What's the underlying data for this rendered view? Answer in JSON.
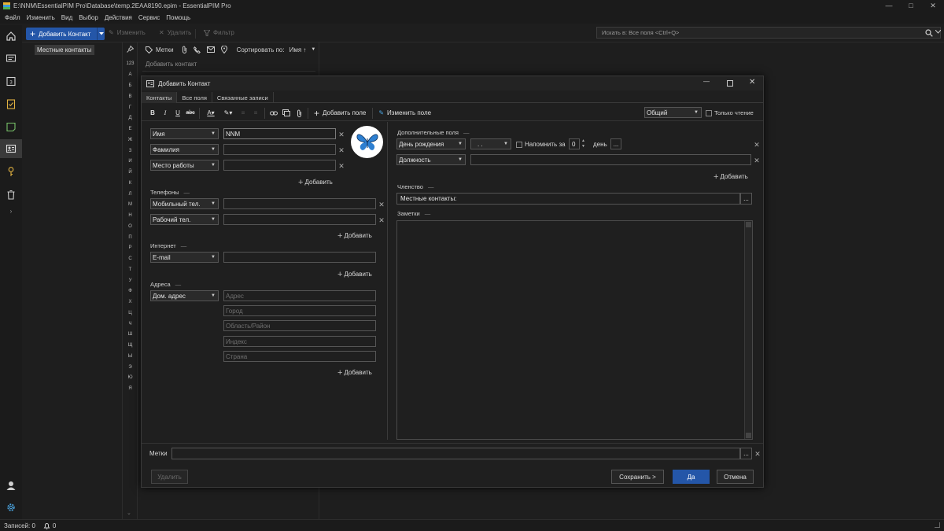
{
  "window": {
    "title": "E:\\NNM\\EssentialPIM Pro\\Database\\temp.2EAA8190.epim - EssentialPIM Pro"
  },
  "menu": [
    "Файл",
    "Изменить",
    "Вид",
    "Выбор",
    "Действия",
    "Сервис",
    "Помощь"
  ],
  "toolbar": {
    "add_contact": "Добавить Контакт",
    "edit": "Изменить",
    "delete": "Удалить",
    "filter": "Фильтр",
    "search_placeholder": "Искать в: Все поля  <Ctrl+Q>"
  },
  "left_panel": {
    "local_contacts": "Местные контакты"
  },
  "alphabet": [
    "123",
    "A",
    "Б",
    "В",
    "Г",
    "Д",
    "Е",
    "Ж",
    "З",
    "И",
    "Й",
    "К",
    "Л",
    "М",
    "Н",
    "О",
    "П",
    "Р",
    "С",
    "Т",
    "У",
    "Ф",
    "Х",
    "Ц",
    "Ч",
    "Ш",
    "Щ",
    "Ы",
    "Э",
    "Ю",
    "Я"
  ],
  "list": {
    "tags": "Метки",
    "sort_by": "Сортировать по:",
    "sort_value": "Имя ↑",
    "add_contact_hint": "Добавить контакт"
  },
  "status": {
    "records": "Записей: 0",
    "notifications": "0"
  },
  "dialog": {
    "title": "Добавить Контакт",
    "tabs": [
      "Контакты",
      "Все поля",
      "Связанные записи"
    ],
    "format": {
      "bold": "B",
      "italic": "I",
      "underline": "U",
      "strike": "abc",
      "add_field": "Добавить поле",
      "edit_field": "Изменить поле",
      "category": "Общий",
      "readonly": "Только чтение"
    },
    "name_fields": [
      {
        "label": "Имя",
        "value": "NNM"
      },
      {
        "label": "Фамилия",
        "value": ""
      },
      {
        "label": "Место работы",
        "value": ""
      }
    ],
    "add": "Добавить",
    "phones": {
      "title": "Телефоны",
      "items": [
        {
          "label": "Мобильный тел.",
          "value": ""
        },
        {
          "label": "Рабочий тел.",
          "value": ""
        }
      ]
    },
    "internet": {
      "title": "Интернет",
      "items": [
        {
          "label": "E-mail",
          "value": ""
        }
      ]
    },
    "addresses": {
      "title": "Адреса",
      "type": "Дом. адрес",
      "placeholders": [
        "Адрес",
        "Город",
        "Область/Район",
        "Индекс",
        "Страна"
      ]
    },
    "extra": {
      "title": "Дополнительные поля",
      "birthday": "День рождения",
      "date_value": ". .",
      "remind": "Напомнить за",
      "days_value": "0",
      "day_unit": "день",
      "position": "Должность"
    },
    "membership": {
      "title": "Членство",
      "value": "Местные контакты:"
    },
    "notes": {
      "title": "Заметки"
    },
    "tags_label": "Метки",
    "buttons": {
      "delete": "Удалить",
      "save": "Сохранить >",
      "ok": "Да",
      "cancel": "Отмена"
    }
  }
}
